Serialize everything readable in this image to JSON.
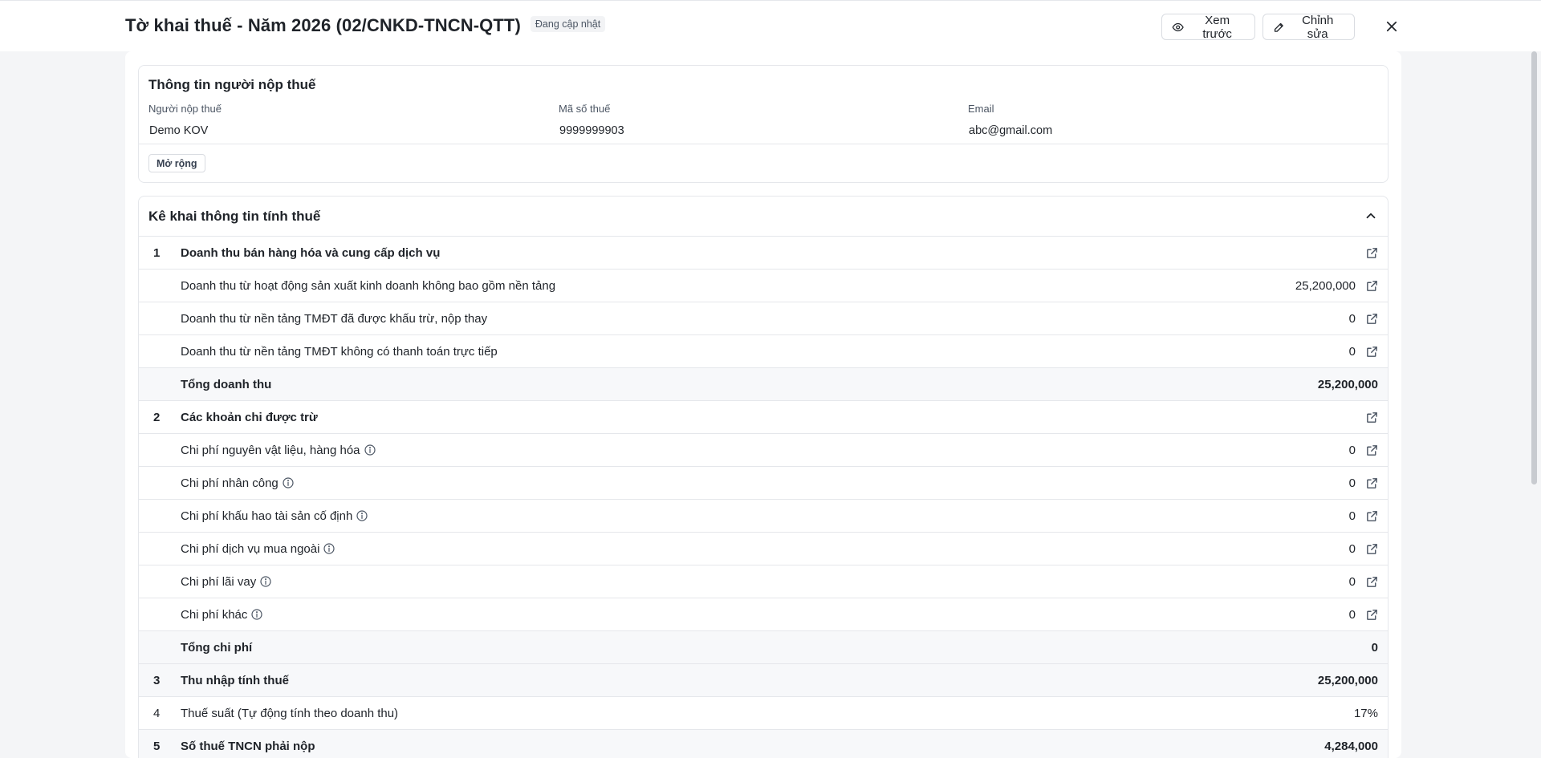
{
  "header": {
    "title": "Tờ khai thuế - Năm 2026 (02/CNKD-TNCN-QTT)",
    "status": "Đang cập nhật",
    "preview_label": "Xem trước",
    "edit_label": "Chỉnh sửa"
  },
  "taxpayer": {
    "title": "Thông tin người nộp thuế",
    "fields": [
      {
        "label": "Người nộp thuế",
        "value": "Demo KOV"
      },
      {
        "label": "Mã số thuế",
        "value": "9999999903"
      },
      {
        "label": "Email",
        "value": "abc@gmail.com"
      }
    ],
    "expand_label": "Mở rộng"
  },
  "calculation": {
    "title": "Kê khai thông tin tính thuế",
    "rows": [
      {
        "no": "1",
        "label": "Doanh thu bán hàng hóa và cung cấp dịch vụ",
        "value": "",
        "bold": true,
        "shade": false,
        "link": true,
        "info": false
      },
      {
        "no": "",
        "label": "Doanh thu từ hoạt động sản xuất kinh doanh không bao gồm nền tảng",
        "value": "25,200,000",
        "bold": false,
        "shade": false,
        "link": true,
        "info": false
      },
      {
        "no": "",
        "label": "Doanh thu từ nền tảng TMĐT đã được khấu trừ, nộp thay",
        "value": "0",
        "bold": false,
        "shade": false,
        "link": true,
        "info": false
      },
      {
        "no": "",
        "label": "Doanh thu từ nền tảng TMĐT không có thanh toán trực tiếp",
        "value": "0",
        "bold": false,
        "shade": false,
        "link": true,
        "info": false
      },
      {
        "no": "",
        "label": "Tổng doanh thu",
        "value": "25,200,000",
        "bold": true,
        "shade": true,
        "link": false,
        "info": false
      },
      {
        "no": "2",
        "label": "Các khoản chi được trừ",
        "value": "",
        "bold": true,
        "shade": false,
        "link": true,
        "info": false
      },
      {
        "no": "",
        "label": "Chi phí nguyên vật liệu, hàng hóa",
        "value": "0",
        "bold": false,
        "shade": false,
        "link": true,
        "info": true
      },
      {
        "no": "",
        "label": "Chi phí nhân công",
        "value": "0",
        "bold": false,
        "shade": false,
        "link": true,
        "info": true
      },
      {
        "no": "",
        "label": "Chi phí khấu hao tài sản cố định",
        "value": "0",
        "bold": false,
        "shade": false,
        "link": true,
        "info": true
      },
      {
        "no": "",
        "label": "Chi phí dịch vụ mua ngoài",
        "value": "0",
        "bold": false,
        "shade": false,
        "link": true,
        "info": true
      },
      {
        "no": "",
        "label": "Chi phí lãi vay",
        "value": "0",
        "bold": false,
        "shade": false,
        "link": true,
        "info": true
      },
      {
        "no": "",
        "label": "Chi phí khác",
        "value": "0",
        "bold": false,
        "shade": false,
        "link": true,
        "info": true
      },
      {
        "no": "",
        "label": "Tổng chi phí",
        "value": "0",
        "bold": true,
        "shade": true,
        "link": false,
        "info": false
      },
      {
        "no": "3",
        "label": "Thu nhập tính thuế",
        "value": "25,200,000",
        "bold": true,
        "shade": true,
        "link": false,
        "info": false
      },
      {
        "no": "4",
        "label": "Thuế suất (Tự động tính theo doanh thu)",
        "value": "17%",
        "bold": false,
        "shade": false,
        "link": false,
        "info": false
      },
      {
        "no": "5",
        "label": "Số thuế TNCN phải nộp",
        "value": "4,284,000",
        "bold": true,
        "shade": true,
        "link": false,
        "info": false
      }
    ]
  },
  "icons": {
    "preview": "eye-icon",
    "edit": "pencil-icon",
    "close": "close-icon",
    "collapse": "chevron-up-icon",
    "row_link": "external-link-icon",
    "row_info": "info-circle-icon"
  }
}
